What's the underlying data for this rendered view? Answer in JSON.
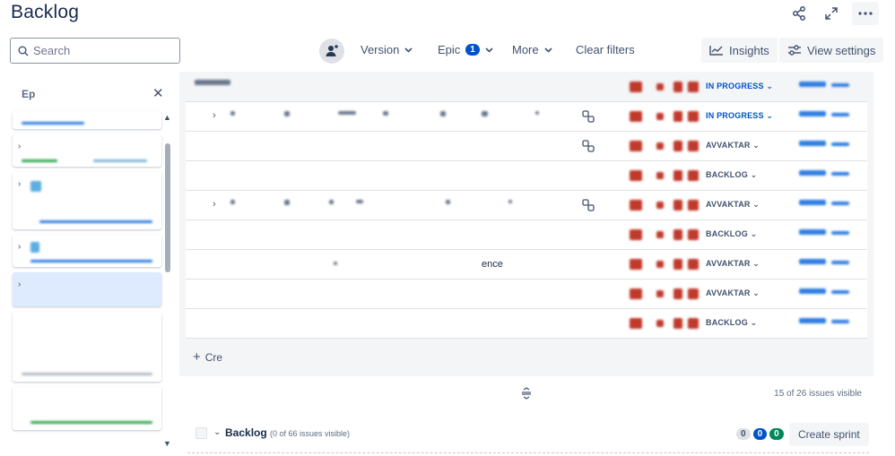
{
  "page": {
    "title": "Backlog"
  },
  "search": {
    "placeholder": "Search"
  },
  "filters": {
    "version_label": "Version",
    "epic_label": "Epic",
    "epic_count": "1",
    "more_label": "More",
    "clear_label": "Clear filters"
  },
  "toolbar": {
    "insights_label": "Insights",
    "view_settings_label": "View settings"
  },
  "epic_panel": {
    "title": "Ep"
  },
  "issues": [
    {
      "status": "IN PROGRESS",
      "status_kind": "inprogress",
      "expandable": false,
      "has_subtasks": false,
      "summary": ""
    },
    {
      "status": "IN PROGRESS",
      "status_kind": "inprogress",
      "expandable": true,
      "has_subtasks": true,
      "summary": ""
    },
    {
      "status": "AVVAKTAR",
      "status_kind": "default",
      "expandable": false,
      "has_subtasks": true,
      "summary": ""
    },
    {
      "status": "BACKLOG",
      "status_kind": "default",
      "expandable": false,
      "has_subtasks": false,
      "summary": ""
    },
    {
      "status": "AVVAKTAR",
      "status_kind": "default",
      "expandable": true,
      "has_subtasks": true,
      "summary": ""
    },
    {
      "status": "BACKLOG",
      "status_kind": "default",
      "expandable": false,
      "has_subtasks": false,
      "summary": ""
    },
    {
      "status": "AVVAKTAR",
      "status_kind": "default",
      "expandable": false,
      "has_subtasks": false,
      "summary": "ence"
    },
    {
      "status": "AVVAKTAR",
      "status_kind": "default",
      "expandable": false,
      "has_subtasks": false,
      "summary": ""
    },
    {
      "status": "BACKLOG",
      "status_kind": "default",
      "expandable": false,
      "has_subtasks": false,
      "summary": ""
    }
  ],
  "sprint": {
    "create_label": "Cre",
    "issues_visible": "15 of 26 issues visible"
  },
  "backlog": {
    "title": "Backlog",
    "subtitle": "(0 of 66 issues visible)",
    "todo_count": "0",
    "in_progress_count": "0",
    "done_count": "0",
    "create_sprint_label": "Create sprint"
  },
  "colors": {
    "accent": "#0052cc",
    "done": "#00875a",
    "priority": "#c0392b"
  }
}
